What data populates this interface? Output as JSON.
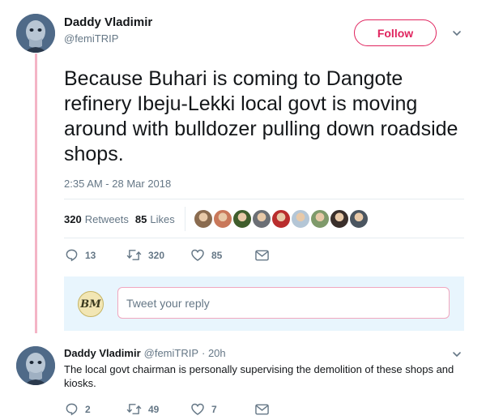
{
  "tweet": {
    "author_name": "Daddy Vladimir",
    "author_handle": "@femiTRIP",
    "follow_label": "Follow",
    "text": "Because Buhari is coming to Dangote refinery Ibeju-Lekki local govt is moving around with bulldozer pulling down roadside shops.",
    "timestamp": "2:35 AM - 28 Mar 2018",
    "retweets_count": "320",
    "retweets_label": "Retweets",
    "likes_count": "85",
    "likes_label": "Likes",
    "likers": [
      {
        "color": "#8a6b4f"
      },
      {
        "color": "#c9785a"
      },
      {
        "color": "#3f5d2c"
      },
      {
        "color": "#6b6f75"
      },
      {
        "color": "#b92d2d"
      },
      {
        "color": "#b4c6d6"
      },
      {
        "color": "#7f9a6b"
      },
      {
        "color": "#3a2f2b"
      },
      {
        "color": "#4a5560"
      }
    ],
    "actions": {
      "replies": "13",
      "retweets": "320",
      "likes": "85"
    }
  },
  "reply_box": {
    "avatar_text": "BM",
    "placeholder": "Tweet your reply"
  },
  "reply": {
    "author_name": "Daddy Vladimir",
    "author_handle": "@femiTRIP",
    "time": "· 20h",
    "text": "The local govt chairman is personally supervising the demolition of these shops and kiosks.",
    "actions": {
      "replies": "2",
      "retweets": "49",
      "likes": "7"
    }
  },
  "colors": {
    "accent": "#e0245e",
    "thread": "#f4b4c6",
    "muted": "#657786",
    "reply_bg": "#e8f5fd"
  },
  "icons": {
    "reply": "reply-icon",
    "retweet": "retweet-icon",
    "like": "heart-icon",
    "dm": "envelope-icon",
    "caret": "chevron-down-icon"
  }
}
